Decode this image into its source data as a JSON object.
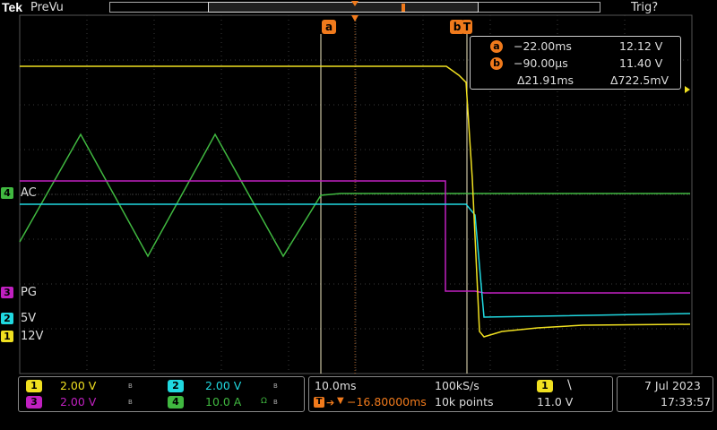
{
  "header": {
    "brand": "Tek",
    "mode": "PreVu",
    "trigger_status": "Trig?"
  },
  "colors": {
    "ch1": "#f0e020",
    "ch2": "#20d8e0",
    "ch3": "#c020c0",
    "ch4": "#40b840",
    "cursor": "#f07a1c",
    "grid": "#3a3a3a"
  },
  "channels": {
    "ch1": {
      "number": "1",
      "label": "12V"
    },
    "ch2": {
      "number": "2",
      "label": "5V"
    },
    "ch3": {
      "number": "3",
      "label": "PG"
    },
    "ch4": {
      "number": "4",
      "label": "AC"
    }
  },
  "cursors": {
    "a": {
      "tag": "a",
      "time": "−22.00ms",
      "value": "12.12 V"
    },
    "b": {
      "tag": "b",
      "time": "−90.00µs",
      "value": "11.40 V"
    },
    "delta_time": "Δ21.91ms",
    "delta_value": "Δ722.5mV",
    "trigger_tag": "T"
  },
  "vertical": {
    "ch1_scale": "2.00 V",
    "ch2_scale": "2.00 V",
    "ch3_scale": "2.00 V",
    "ch4_scale": "10.0 A",
    "bw_mark": "B",
    "omega_mark": "Ω"
  },
  "horizontal": {
    "timebase": "10.0ms",
    "sample_rate": "100kS/s",
    "position": "−16.80000ms",
    "record_length": "10k points"
  },
  "trigger": {
    "source": "1",
    "slope": "\\",
    "level": "11.0 V"
  },
  "datetime": {
    "date": "7 Jul  2023",
    "time": "17:33:57"
  }
}
